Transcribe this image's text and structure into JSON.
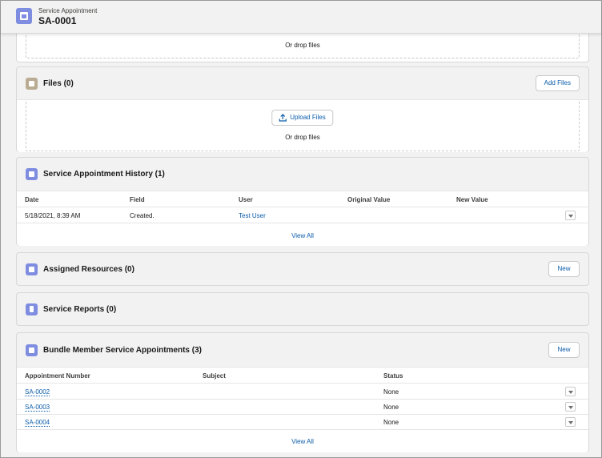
{
  "header": {
    "object_type": "Service Appointment",
    "record_name": "SA-0001"
  },
  "top_drop": {
    "drop_text": "Or drop files"
  },
  "files": {
    "title": "Files (0)",
    "add_button": "Add Files",
    "upload_button": "Upload Files",
    "drop_text": "Or drop files"
  },
  "history": {
    "title": "Service Appointment History (1)",
    "columns": [
      "Date",
      "Field",
      "User",
      "Original Value",
      "New Value"
    ],
    "rows": [
      {
        "date": "5/18/2021, 8:39 AM",
        "field": "Created.",
        "user": "Test User",
        "original": "",
        "new": ""
      }
    ],
    "view_all": "View All"
  },
  "assigned_resources": {
    "title": "Assigned Resources (0)",
    "new_button": "New"
  },
  "service_reports": {
    "title": "Service Reports (0)"
  },
  "bundle_members": {
    "title": "Bundle Member Service Appointments (3)",
    "new_button": "New",
    "columns": [
      "Appointment Number",
      "Subject",
      "Status"
    ],
    "rows": [
      {
        "number": "SA-0002",
        "subject": "",
        "status": "None"
      },
      {
        "number": "SA-0003",
        "subject": "",
        "status": "None"
      },
      {
        "number": "SA-0004",
        "subject": "",
        "status": "None"
      }
    ],
    "view_all": "View All"
  },
  "colors": {
    "accent_blue": "#0b5cab",
    "object_icon": "#7f8de1",
    "files_icon": "#baac93",
    "card_bg": "#f3f2f2"
  }
}
